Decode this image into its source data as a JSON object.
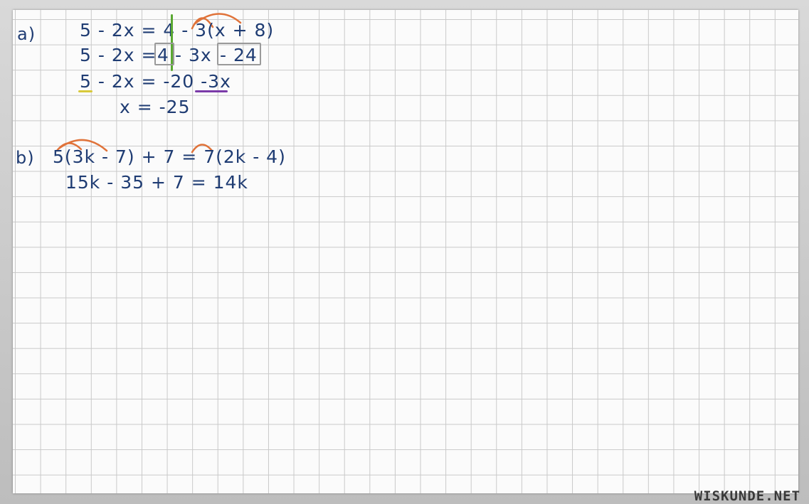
{
  "part_a": {
    "label": "a)",
    "line1": "5 - 2x = 4 - 3(x + 8)",
    "line2_left": "5 - 2x =",
    "line2_box1": "4",
    "line2_mid": "- 3x",
    "line2_box2": "- 24",
    "line3": "5 - 2x = -20 -3x",
    "line4": "x = -25"
  },
  "part_b": {
    "label": "b)",
    "line1": "5(3k - 7) + 7 = 7(2k - 4)",
    "line2": "15k - 35 + 7 = 14k"
  },
  "logo": "WISKUNDE.NET",
  "colors": {
    "ink": "#1f3c73",
    "arc": "#e0733a",
    "green_bar": "#5aa832",
    "yellow_underline": "#d8c93a",
    "purple_underline": "#7a3aa8",
    "box": "#9a9a9a"
  }
}
